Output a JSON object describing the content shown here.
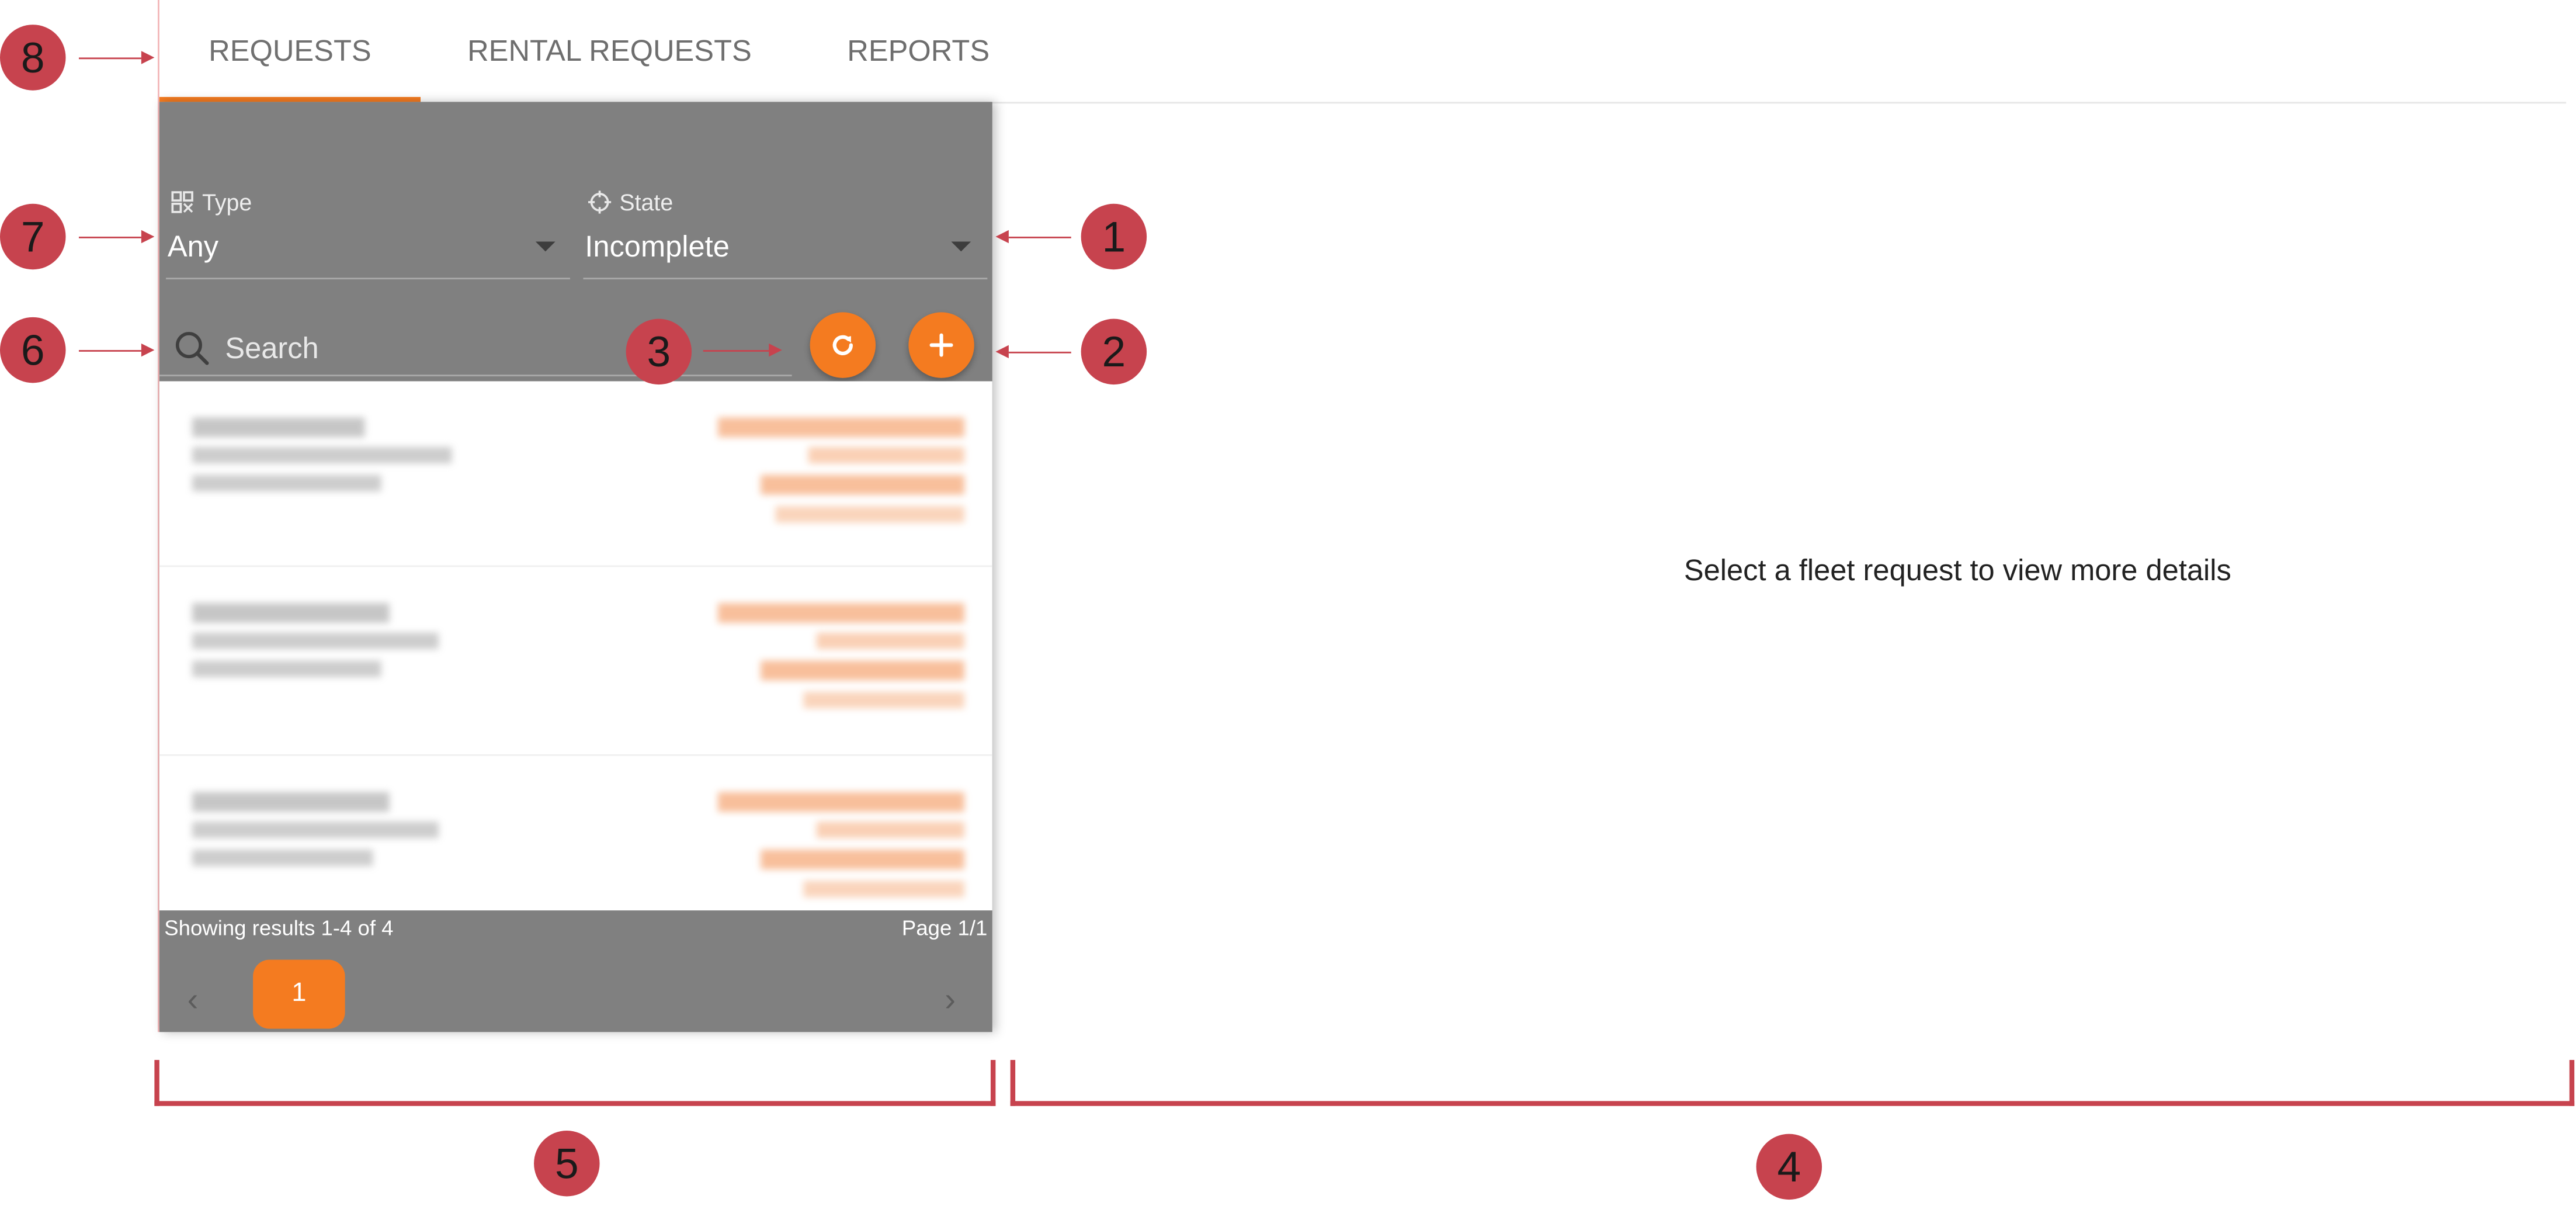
{
  "tabs": {
    "requests": "REQUESTS",
    "rental_requests": "RENTAL REQUESTS",
    "reports": "REPORTS"
  },
  "filters": {
    "type_label": "Type",
    "type_value": "Any",
    "state_label": "State",
    "state_value": "Incomplete"
  },
  "search": {
    "placeholder": "Search"
  },
  "actions": {
    "refresh_icon": "refresh-icon",
    "add_icon": "plus-icon"
  },
  "list": {
    "items": [
      {
        "id": "request-1"
      },
      {
        "id": "request-2"
      },
      {
        "id": "request-3"
      }
    ]
  },
  "pagination": {
    "results_text": "Showing results 1-4 of 4",
    "page_text": "Page 1/1",
    "current_page": "1"
  },
  "detail": {
    "empty_message": "Select a fleet request to view more details"
  },
  "annotations": {
    "badges": [
      "1",
      "2",
      "3",
      "4",
      "5",
      "6",
      "7",
      "8"
    ]
  },
  "colors": {
    "accent": "#f47b20",
    "panel_bg": "#808080",
    "annotation": "#c7434e"
  }
}
